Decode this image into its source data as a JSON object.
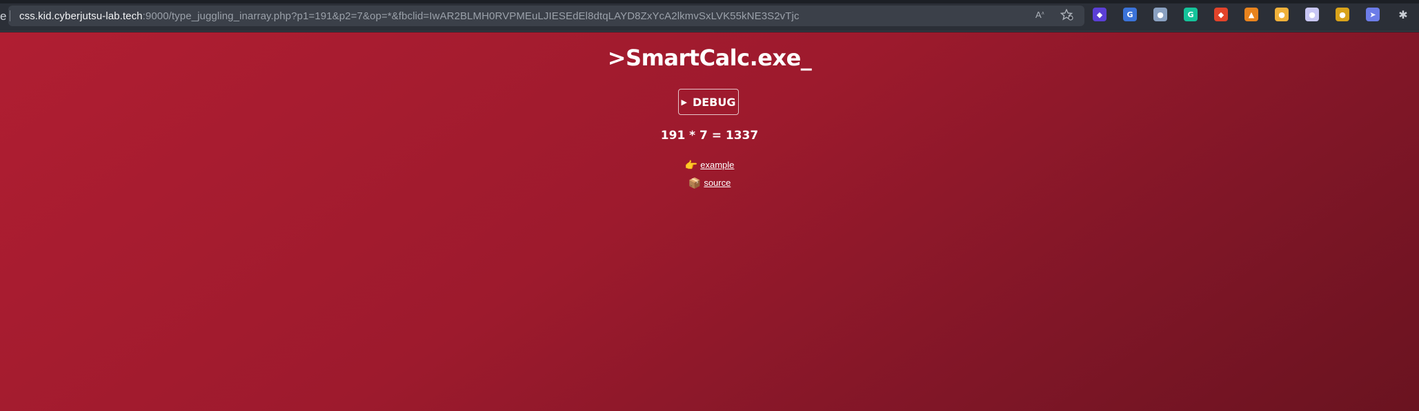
{
  "browser": {
    "url_host": "css.kid.cyberjutsu-lab.tech",
    "url_rest": ":9000/type_juggling_inarray.php?p1=191&p2=7&op=*&fbclid=IwAR2BLMH0RVPMEuLJIESEdEl8dtqLAYD8ZxYcA2lkmvSxLVK55kNE3S2vTjc",
    "tab_partial": "e",
    "icons": [
      "read-aloud-icon",
      "favorite-icon"
    ],
    "extensions": [
      {
        "name": "ext-purple-icon",
        "glyph": "◆",
        "color": "#5b3fd6"
      },
      {
        "name": "ext-translate-icon",
        "glyph": "G",
        "color": "#3b73d9"
      },
      {
        "name": "ext-circle-icon",
        "glyph": "●",
        "color": "#8aa1c1"
      },
      {
        "name": "ext-grammarly-icon",
        "glyph": "G",
        "color": "#15c39a"
      },
      {
        "name": "ext-red-icon",
        "glyph": "◆",
        "color": "#e2432a"
      },
      {
        "name": "ext-metamask-icon",
        "glyph": "▲",
        "color": "#e8831d"
      },
      {
        "name": "ext-yellow-icon",
        "glyph": "●",
        "color": "#f0b13a"
      },
      {
        "name": "ext-cloud-icon",
        "glyph": "●",
        "color": "#c8c6f4"
      },
      {
        "name": "ext-bee-icon",
        "glyph": "●",
        "color": "#d8a21a"
      },
      {
        "name": "ext-cursor-icon",
        "glyph": "➤",
        "color": "#6c7ce8"
      },
      {
        "name": "extensions-puzzle-icon",
        "glyph": "✱",
        "color": "#2b2f37"
      }
    ]
  },
  "page": {
    "title": ">SmartCalc.exe_",
    "debug_label": "DEBUG",
    "debug_icon": "▶",
    "result": "191 * 7 = 1337",
    "links": [
      {
        "emoji": "👉",
        "label": "example"
      },
      {
        "emoji": "📦",
        "label": "source"
      }
    ]
  }
}
